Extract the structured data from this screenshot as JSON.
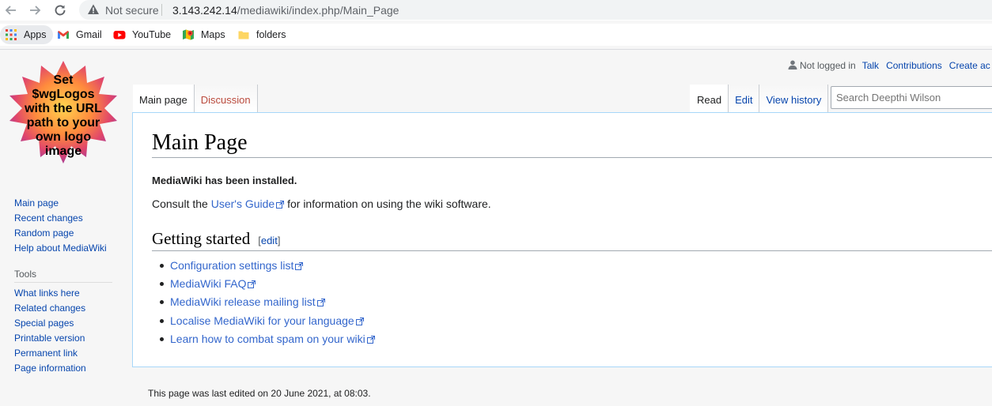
{
  "browser": {
    "not_secure": "Not secure",
    "url_host": "3.143.242.14",
    "url_path": "/mediawiki/index.php/Main_Page",
    "bookmarks": [
      {
        "label": "Apps",
        "icon": "apps-grid-icon"
      },
      {
        "label": "Gmail",
        "icon": "gmail-icon"
      },
      {
        "label": "YouTube",
        "icon": "youtube-icon"
      },
      {
        "label": "Maps",
        "icon": "maps-icon"
      },
      {
        "label": "folders",
        "icon": "folder-icon"
      }
    ]
  },
  "logo_text": "Set $wgLogos with the URL path to your own logo image",
  "personal": {
    "not_logged_in": "Not logged in",
    "talk": "Talk",
    "contributions": "Contributions",
    "create_account": "Create ac"
  },
  "navigation": {
    "items": [
      "Main page",
      "Recent changes",
      "Random page",
      "Help about MediaWiki"
    ]
  },
  "tools": {
    "heading": "Tools",
    "items": [
      "What links here",
      "Related changes",
      "Special pages",
      "Printable version",
      "Permanent link",
      "Page information"
    ]
  },
  "tabs": {
    "main_page": "Main page",
    "discussion": "Discussion",
    "read": "Read",
    "edit": "Edit",
    "view_history": "View history"
  },
  "search": {
    "placeholder": "Search Deepthi Wilson"
  },
  "content": {
    "title": "Main Page",
    "installed": "MediaWiki has been installed.",
    "consult_prefix": "Consult the ",
    "consult_link": "User's Guide",
    "consult_suffix": " for information on using the wiki software.",
    "section_title": "Getting started",
    "edit_open": "[",
    "edit_label": "edit",
    "edit_close": "]",
    "links": [
      "Configuration settings list",
      "MediaWiki FAQ",
      "MediaWiki release mailing list",
      "Localise MediaWiki for your language",
      "Learn how to combat spam on your wiki"
    ]
  },
  "footer": "This page was last edited on 20 June 2021, at 08:03."
}
